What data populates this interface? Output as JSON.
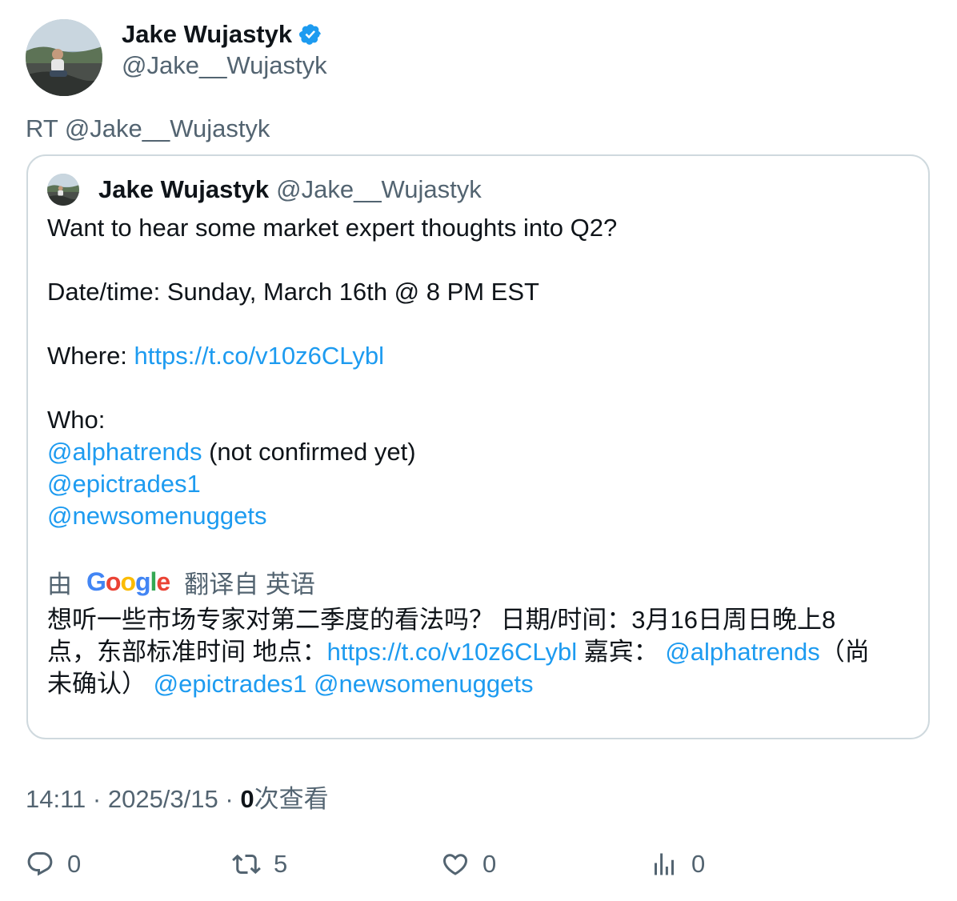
{
  "author": {
    "display_name": "Jake Wujastyk",
    "handle": "@Jake__Wujastyk",
    "verified": true
  },
  "retweet_line": "RT @Jake__Wujastyk",
  "quoted": {
    "display_name": "Jake Wujastyk",
    "handle": "@Jake__Wujastyk",
    "line1": "Want to hear some market expert thoughts into Q2?",
    "line2": "Date/time: Sunday, March 16th @ 8 PM EST",
    "where_label": "Where: ",
    "where_link": "https://t.co/v10z6CLybl",
    "who_label": "Who:",
    "mention1": "@alphatrends",
    "mention1_note": " (not confirmed yet)",
    "mention2": "@epictrades1",
    "mention3": "@newsomenuggets"
  },
  "translation": {
    "prefix": "由",
    "provider": "Google",
    "suffix": "翻译自 英语",
    "line1": "想听一些市场专家对第二季度的看法吗？ 日期/时间：3月16日周日晚上8",
    "line2_text": "点，东部标准时间 地点：",
    "line2_link": "https://t.co/v10z6CLybl",
    "line2_mid": " 嘉宾： ",
    "line2_mention": "@alphatrends",
    "line2_end": "（尚",
    "line3_text": "未确认） ",
    "line3_mention1": "@epictrades1",
    "line3_space": " ",
    "line3_mention2": "@newsomenuggets"
  },
  "meta": {
    "time": "14:11",
    "separator": " · ",
    "date": "2025/3/15",
    "separator2": " · ",
    "views_count": "0",
    "views_label": "次查看"
  },
  "actions": {
    "reply_count": "0",
    "retweet_count": "5",
    "like_count": "0",
    "views_count": "0"
  },
  "colors": {
    "link": "#1d9bf0",
    "secondary": "#536471",
    "border": "#cfd9de",
    "verified": "#1d9bf0"
  }
}
